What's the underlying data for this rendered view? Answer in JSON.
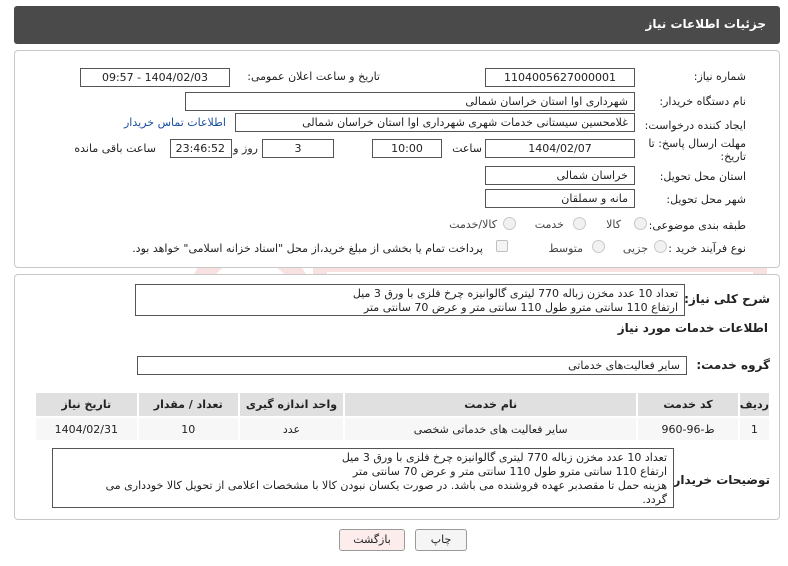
{
  "header": {
    "title": "جزئیات اطلاعات نیاز"
  },
  "form": {
    "need_number_label": "شماره نیاز:",
    "need_number_value": "1104005627000001",
    "announce_label": "تاریخ و ساعت اعلان عمومی:",
    "announce_value": "1404/02/03 - 09:57",
    "buyer_org_label": "نام دستگاه خریدار:",
    "buyer_org_value": "شهرداری اوا استان خراسان شمالی",
    "requester_label": "ایجاد کننده درخواست:",
    "requester_value": "غلامحسین  سیستانی  خدمات شهری شهرداری اوا استان خراسان شمالی",
    "contact_link": "اطلاعات تماس خریدار",
    "deadline_label_1": "مهلت ارسال پاسخ: تا",
    "deadline_label_2": "تاریخ:",
    "deadline_date": "1404/02/07",
    "time_label": "ساعت",
    "deadline_time": "10:00",
    "days_value": "3",
    "days_label": "روز و",
    "remaining_value": "23:46:52",
    "remaining_label": "ساعت باقی مانده",
    "province_label": "استان محل تحویل:",
    "province_value": "خراسان شمالی",
    "city_label": "شهر محل تحویل:",
    "city_value": "مانه و سملقان",
    "category_label": "طبقه بندی موضوعی:",
    "category_options": [
      "کالا",
      "خدمت",
      "کالا/خدمت"
    ],
    "purchase_type_label": "نوع فرآیند خرید :",
    "purchase_options": [
      "جزیی",
      "متوسط"
    ],
    "payment_note": "پرداخت تمام یا بخشی از مبلغ خرید،از محل \"اسناد خزانه اسلامی\" خواهد بود."
  },
  "summary": {
    "label": "شرح کلی نیاز:",
    "text_line1": "تعداد 10 عدد مخزن زباله 770 لیتری گالوانیزه چرخ فلزی با ورق 3 میل",
    "text_line2": "ارتفاع 110 سانتی مترو طول 110 سانتی متر و عرض 70 سانتی متر"
  },
  "services": {
    "section_title": "اطلاعات خدمات مورد نیاز",
    "group_label": "گروه خدمت:",
    "group_value": "سایر فعالیت‌های خدماتی",
    "columns": [
      "ردیف",
      "کد خدمت",
      "نام خدمت",
      "واحد اندازه گیری",
      "تعداد / مقدار",
      "تاریخ نیاز"
    ],
    "rows": [
      {
        "row": "1",
        "code": "ط-96-960",
        "name": "سایر فعالیت های خدماتی شخصی",
        "unit": "عدد",
        "qty": "10",
        "date": "1404/02/31"
      }
    ]
  },
  "buyer_notes": {
    "label": "توضیحات خریدار:",
    "line1": "تعداد 10 عدد مخزن زباله 770 لیتری گالوانیزه چرخ فلزی با ورق 3 میل",
    "line2": "ارتفاع 110 سانتی مترو طول 110 سانتی متر و عرض 70 سانتی متر",
    "line3": "هزینه حمل تا مقصدبر عهده فروشنده می باشد. در صورت یکسان نبودن کالا با مشخصات اعلامی از تحویل کالا خودداری می",
    "line4": "گردد."
  },
  "buttons": {
    "print": "چاپ",
    "back": "بازگشت"
  },
  "colors": {
    "header_bg": "#4a4a4a",
    "link": "#1a4fa0",
    "back_button_bg": "#fdecec"
  }
}
